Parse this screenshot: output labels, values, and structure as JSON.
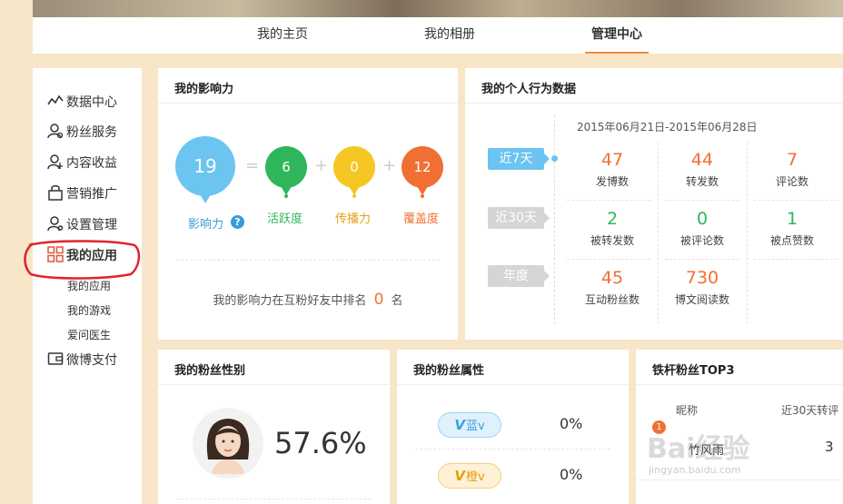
{
  "nav": {
    "tabs": [
      {
        "label": "我的主页",
        "active": false
      },
      {
        "label": "我的相册",
        "active": false
      },
      {
        "label": "管理中心",
        "active": true
      }
    ]
  },
  "sidebar": {
    "items": [
      {
        "label": "数据中心",
        "icon": "chart-line-icon"
      },
      {
        "label": "粉丝服务",
        "icon": "fans-user-icon"
      },
      {
        "label": "内容收益",
        "icon": "income-user-icon"
      },
      {
        "label": "营销推广",
        "icon": "bag-icon"
      },
      {
        "label": "设置管理",
        "icon": "settings-user-icon"
      },
      {
        "label": "我的应用",
        "icon": "apps-grid-icon"
      },
      {
        "label": "微博支付",
        "icon": "wallet-icon"
      }
    ],
    "sub_items": [
      "我的应用",
      "我的游戏",
      "爱问医生"
    ]
  },
  "influence": {
    "title": "我的影响力",
    "total": {
      "value": "19",
      "label": "影响力",
      "color": "#6cc4f0"
    },
    "equals": "=",
    "plus": "+",
    "activity": {
      "value": "6",
      "label": "活跃度",
      "color": "#2fb65a"
    },
    "spread": {
      "value": "0",
      "label": "传播力",
      "color": "#f6c623"
    },
    "coverage": {
      "value": "12",
      "label": "覆盖度",
      "color": "#f07033"
    },
    "rank_prefix": "我的影响力在互粉好友中排名",
    "rank_value": "0",
    "rank_suffix": "名",
    "help_icon": "question-circle-icon"
  },
  "behavior": {
    "title": "我的个人行为数据",
    "date_range": "2015年06月21日-2015年06月28日",
    "periods": [
      {
        "label": "近7天",
        "active": true
      },
      {
        "label": "近30天",
        "active": false
      },
      {
        "label": "年度",
        "active": false
      }
    ],
    "stats": [
      {
        "value": "47",
        "label": "发博数",
        "color": "#f07033"
      },
      {
        "value": "44",
        "label": "转发数",
        "color": "#f07033"
      },
      {
        "value": "7",
        "label": "评论数",
        "color": "#f07033"
      },
      {
        "value": "2",
        "label": "被转发数",
        "color": "#2fb65a"
      },
      {
        "value": "0",
        "label": "被评论数",
        "color": "#2fb65a"
      },
      {
        "value": "1",
        "label": "被点赞数",
        "color": "#2fb65a"
      },
      {
        "value": "45",
        "label": "互动粉丝数",
        "color": "#f07033"
      },
      {
        "value": "730",
        "label": "博文阅读数",
        "color": "#f07033"
      }
    ]
  },
  "fans_gender": {
    "title": "我的粉丝性别",
    "percent": "57.6%",
    "avatar_icon": "female-avatar-icon"
  },
  "fans_attr": {
    "title": "我的粉丝属性",
    "rows": [
      {
        "badge_v": "V",
        "badge_label": "蓝v",
        "value": "0%",
        "color": "#3aa0e0"
      },
      {
        "badge_v": "V",
        "badge_label": "橙v",
        "value": "0%",
        "color": "#f2a51a"
      }
    ]
  },
  "top_fans": {
    "title": "铁杆粉丝TOP3",
    "col_name": "昵称",
    "col_count": "近30天转评",
    "rows": [
      {
        "rank": "1",
        "name": "竹风雨",
        "count": "3"
      }
    ]
  },
  "watermark": {
    "text": "Bai经验",
    "subtext": "jingyan.baidu.com"
  }
}
